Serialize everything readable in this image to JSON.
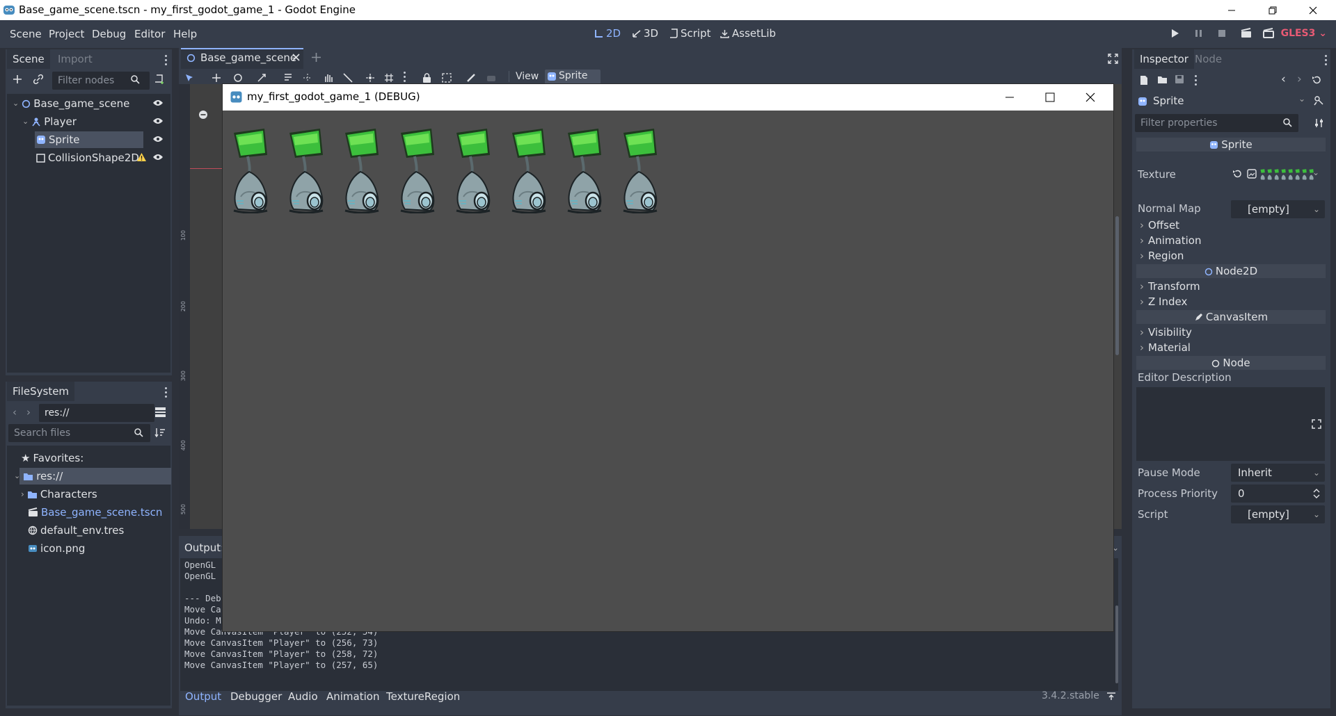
{
  "window": {
    "title": "Base_game_scene.tscn - my_first_godot_game_1 - Godot Engine"
  },
  "menu": [
    "Scene",
    "Project",
    "Debug",
    "Editor",
    "Help"
  ],
  "workspaces": {
    "2d": "2D",
    "3d": "3D",
    "script": "Script",
    "assetlib": "AssetLib"
  },
  "renderer": "GLES3",
  "scene_dock": {
    "tabs": [
      "Scene",
      "Import"
    ],
    "filter_placeholder": "Filter nodes",
    "nodes": [
      {
        "name": "Base_game_scene",
        "icon": "node2d-icon"
      },
      {
        "name": "Player",
        "icon": "kinematic-body-icon"
      },
      {
        "name": "Sprite",
        "icon": "sprite-icon",
        "selected": true
      },
      {
        "name": "CollisionShape2D",
        "icon": "collision-shape-icon",
        "warning": true
      }
    ]
  },
  "filesystem": {
    "tab": "FileSystem",
    "path": "res://",
    "search_placeholder": "Search files",
    "favorites_label": "Favorites:",
    "items": [
      {
        "name": "res://",
        "icon": "folder-icon"
      },
      {
        "name": "Characters",
        "icon": "folder-icon"
      },
      {
        "name": "Base_game_scene.tscn",
        "icon": "scene-file-icon"
      },
      {
        "name": "default_env.tres",
        "icon": "environment-icon"
      },
      {
        "name": "icon.png",
        "icon": "image-icon"
      }
    ]
  },
  "editor": {
    "scene_tab": "Base_game_scene",
    "toolbar_view": "View",
    "toolbar_sprite": "Sprite",
    "ruler_ticks": [
      "100",
      "200",
      "300",
      "400",
      "500"
    ]
  },
  "game_window": {
    "title": "my_first_godot_game_1 (DEBUG)",
    "sprite_count": 8
  },
  "output": {
    "title": "Output:",
    "lines": [
      "OpenGL",
      "OpenGL",
      "",
      "--- Deb",
      "Move Ca",
      "Undo: M",
      "Move CanvasItem \"Player\" to (252, 54)",
      "Move CanvasItem \"Player\" to (256, 73)",
      "Move CanvasItem \"Player\" to (258, 72)",
      "Move CanvasItem \"Player\" to (257, 65)"
    ],
    "bottom_tabs": [
      "Output",
      "Debugger",
      "Audio",
      "Animation",
      "TextureRegion"
    ],
    "version": "3.4.2.stable"
  },
  "inspector": {
    "tabs": [
      "Inspector",
      "Node"
    ],
    "object": "Sprite",
    "filter_placeholder": "Filter properties",
    "section_sprite": "Sprite",
    "texture_label": "Texture",
    "normal_map_label": "Normal Map",
    "normal_map_value": "[empty]",
    "groups_sprite": [
      "Offset",
      "Animation",
      "Region"
    ],
    "section_node2d": "Node2D",
    "groups_node2d": [
      "Transform",
      "Z Index"
    ],
    "section_canvasitem": "CanvasItem",
    "groups_canvasitem": [
      "Visibility",
      "Material"
    ],
    "section_node": "Node",
    "editor_description_label": "Editor Description",
    "pause_mode_label": "Pause Mode",
    "pause_mode_value": "Inherit",
    "process_priority_label": "Process Priority",
    "process_priority_value": "0",
    "script_label": "Script",
    "script_value": "[empty]"
  },
  "colors": {
    "accent": "#8fb4ff",
    "gles": "#e85a74",
    "panel": "#363d4a",
    "game_bg": "#4d4d4d"
  }
}
